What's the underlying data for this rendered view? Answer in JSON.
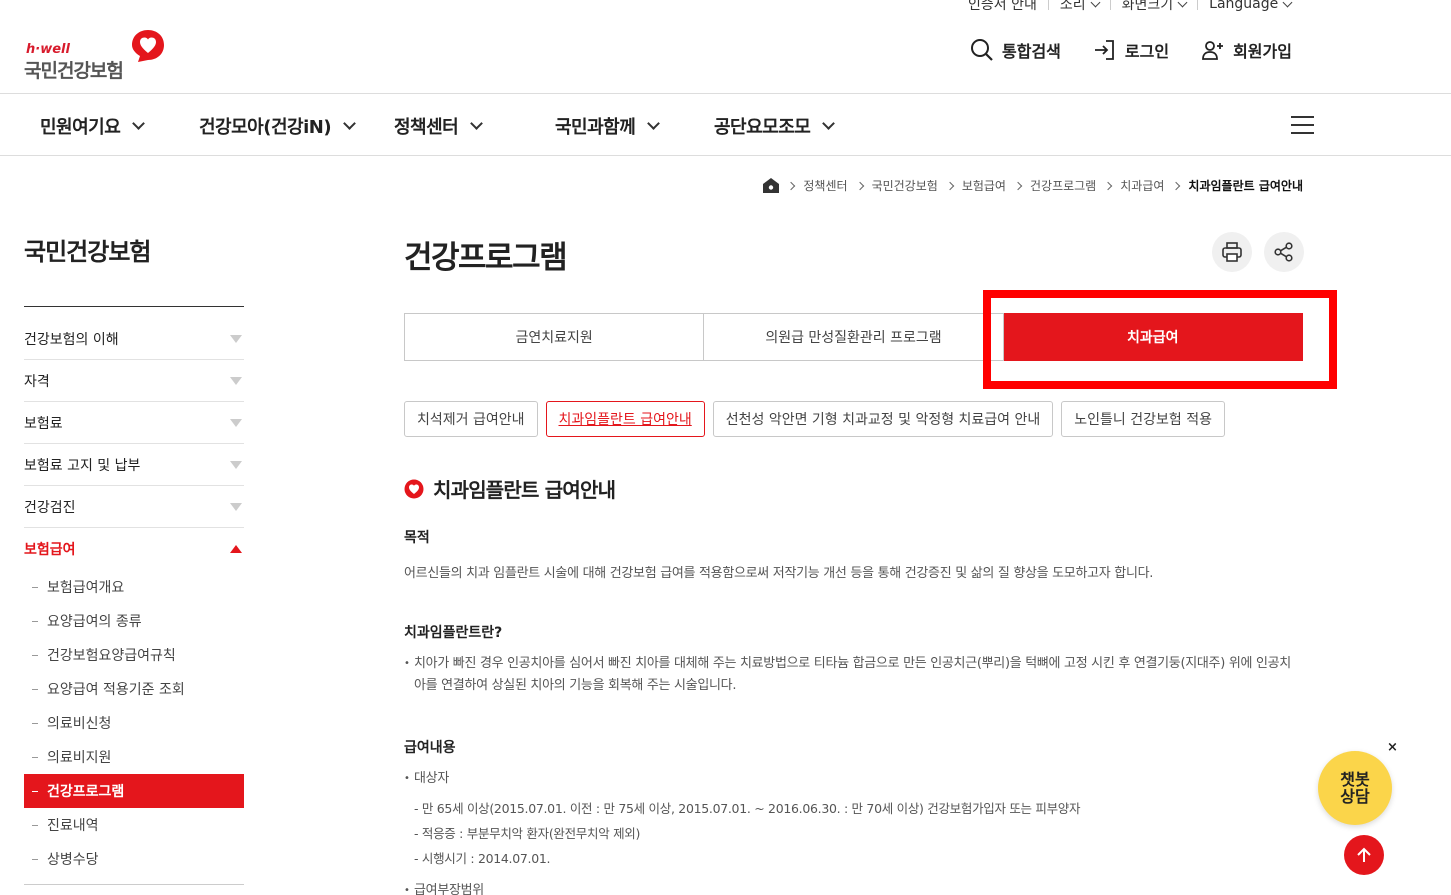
{
  "util": [
    "인증서 안내",
    "소리",
    "화면크기",
    "Language"
  ],
  "logo": {
    "tagline": "h·well",
    "name": "국민건강보험"
  },
  "actions": {
    "search": "통합검색",
    "login": "로그인",
    "join": "회원가입"
  },
  "gnb": [
    "민원여기요",
    "건강모아(건강iN)",
    "정책센터",
    "국민과함께",
    "공단요모조모"
  ],
  "breadcrumb": [
    "정책센터",
    "국민건강보험",
    "보험급여",
    "건강프로그램",
    "치과급여",
    "치과임플란트 급여안내"
  ],
  "lnb": {
    "title": "국민건강보험",
    "groups": [
      "건강보험의 이해",
      "자격",
      "보험료",
      "보험료 고지 및 납부",
      "건강검진",
      "보험급여"
    ],
    "subs": [
      "보험급여개요",
      "요양급여의 종류",
      "건강보험요양급여규칙",
      "요양급여 적용기준 조회",
      "의료비신청",
      "의료비지원",
      "건강프로그램",
      "진료내역",
      "상병수당"
    ]
  },
  "page": {
    "title": "건강프로그램",
    "tabs": [
      "금연치료지원",
      "의원급 만성질환관리 프로그램",
      "치과급여"
    ],
    "subtabs": [
      "치석제거 급여안내",
      "치과임플란트 급여안내",
      "선천성 악안면 기형 치과교정 및 악정형 치료급여 안내",
      "노인틀니 건강보험 적용"
    ],
    "section_title": "치과임플란트 급여안내",
    "purpose_h": "목적",
    "purpose": "어르신들의 치과 임플란트 시술에 대해 건강보험 급여를 적용함으로써 저작기능 개선 등을 통해 건강증진 및 삶의 질 향상을 도모하고자 합니다.",
    "what_h": "치과임플란트란?",
    "what": "치아가 빠진 경우 인공치아를 심어서 빠진 치아를 대체해 주는 치료방법으로 티타늄 합금으로 만든 인공치근(뿌리)을 턱뼈에 고정 시킨 후 연결기둥(지대주) 위에 인공치아를 연결하여 상실된 치아의 기능을 회복해 주는 시술입니다.",
    "benefit_h": "급여내용",
    "target_h": "대상자",
    "target_items": [
      "만 65세 이상(2015.07.01. 이전 : 만 75세 이상, 2015.07.01. ~ 2016.06.30. : 만 70세 이상) 건강보험가입자 또는 피부양자",
      "적응증 : 부분무치악 환자(완전무치악 제외)",
      "시행시기 : 2014.07.01."
    ],
    "scope_h": "급여부장범위"
  },
  "chatbot": {
    "line1": "챗봇",
    "line2": "상담",
    "close": "×"
  }
}
